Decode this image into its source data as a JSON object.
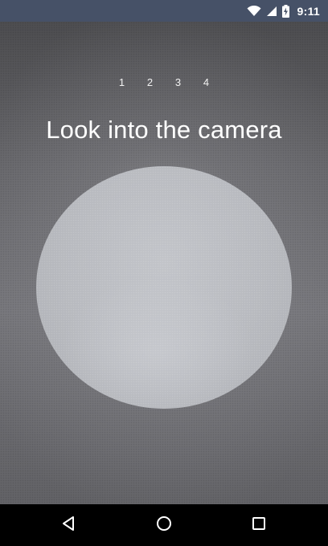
{
  "status_bar": {
    "time": "9:11",
    "icons": [
      "wifi-icon",
      "cell-signal-icon",
      "battery-charging-icon"
    ],
    "background": "#465167"
  },
  "camera": {
    "steps": [
      "1",
      "2",
      "3",
      "4"
    ],
    "title": "Look into the camera"
  },
  "nav_bar": {
    "icons": [
      "back-icon",
      "home-icon",
      "recents-icon"
    ]
  }
}
